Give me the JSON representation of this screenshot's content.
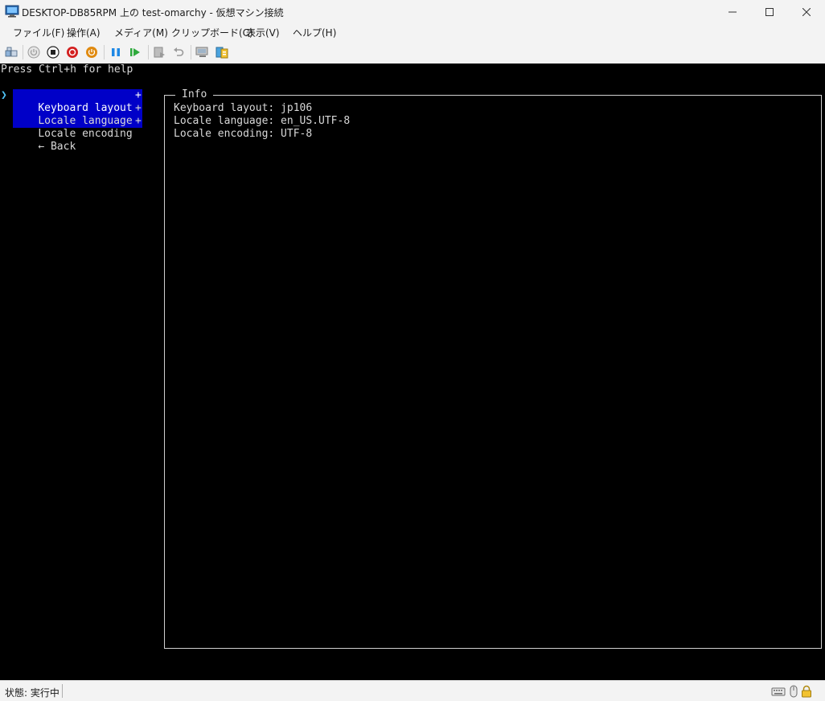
{
  "window": {
    "title": "DESKTOP-DB85RPM 上の test-omarchy  - 仮想マシン接続"
  },
  "menu": [
    "ファイル(F)",
    "操作(A)",
    "メディア(M)",
    "クリップボード(C)",
    "表示(V)",
    "ヘルプ(H)"
  ],
  "toolbar": {
    "icons": [
      "ctrl-alt-del-icon",
      "start-icon",
      "turn-off-icon",
      "shutdown-icon",
      "save-icon",
      "pause-icon",
      "resume-icon",
      "checkpoint-icon",
      "revert-icon",
      "enhanced-session-icon",
      "share-icon"
    ]
  },
  "console": {
    "help_line": "Press Ctrl+h for help",
    "cursor": "❯",
    "menu_items": [
      {
        "label": "Keyboard layout",
        "suffix": "+",
        "selected": true
      },
      {
        "label": "Locale language",
        "suffix": "+",
        "selected": false
      },
      {
        "label": "Locale encoding",
        "suffix": "+",
        "selected": false
      },
      {
        "label": "← Back",
        "suffix": "",
        "selected": false
      }
    ],
    "info_title": "Info",
    "info_lines": [
      "Keyboard layout: jp106",
      "Locale language: en_US.UTF-8",
      "Locale encoding: UTF-8"
    ]
  },
  "status": {
    "text": "状態: 実行中",
    "icons": [
      "keyboard-icon",
      "mouse-icon",
      "lock-icon"
    ]
  },
  "colors": {
    "console_bg": "#000000",
    "console_fg": "#d8d8d8",
    "selection_bg": "#0000c8",
    "cursor": "#4fc3f7"
  }
}
